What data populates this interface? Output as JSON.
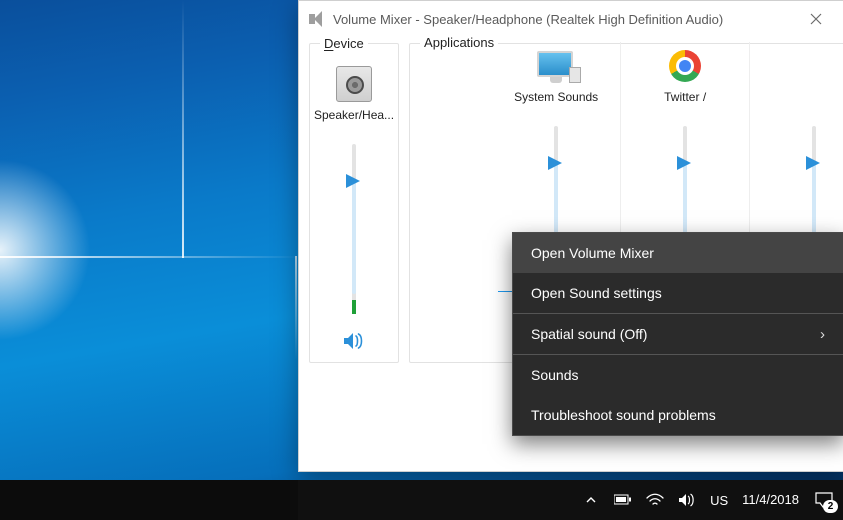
{
  "window": {
    "title": "Volume Mixer - Speaker/Headphone (Realtek High Definition Audio)"
  },
  "panels": {
    "device_label_prefix": "D",
    "device_label_rest": "evice",
    "apps_label": "Applications"
  },
  "columns": {
    "device": {
      "label": "Speaker/Hea...",
      "level": 78
    },
    "system": {
      "label": "System Sounds",
      "level": 78
    },
    "twitter": {
      "label": "Twitter /",
      "level": 78
    }
  },
  "context_menu": {
    "open_mixer": "Open Volume Mixer",
    "open_settings": "Open Sound settings",
    "spatial": "Spatial sound (Off)",
    "sounds": "Sounds",
    "troubleshoot": "Troubleshoot sound problems"
  },
  "taskbar": {
    "lang": "US",
    "date": "11/4/2018",
    "notif_count": "2"
  }
}
